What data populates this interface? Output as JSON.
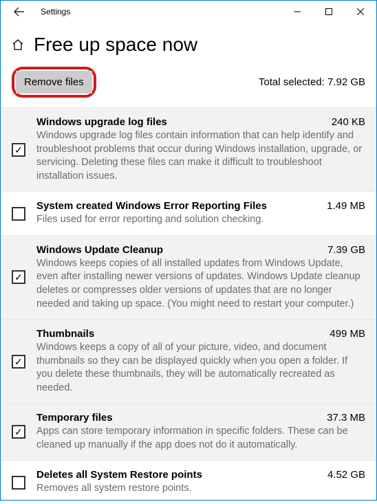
{
  "window": {
    "title": "Settings"
  },
  "page": {
    "title": "Free up space now"
  },
  "action": {
    "remove_label": "Remove files",
    "total_label": "Total selected: 7.92 GB"
  },
  "items": [
    {
      "title": "Windows upgrade log files",
      "size": "240 KB",
      "desc": "Windows upgrade log files contain information that can help identify and troubleshoot problems that occur during Windows installation, upgrade, or servicing.  Deleting these files can make it difficult to troubleshoot installation issues.",
      "checked": true
    },
    {
      "title": "System created Windows Error Reporting Files",
      "size": "1.49 MB",
      "desc": "Files used for error reporting and solution checking.",
      "checked": false
    },
    {
      "title": "Windows Update Cleanup",
      "size": "7.39 GB",
      "desc": "Windows keeps copies of all installed updates from Windows Update, even after installing newer versions of updates. Windows Update cleanup deletes or compresses older versions of updates that are no longer needed and taking up space. (You might need to restart your computer.)",
      "checked": true
    },
    {
      "title": "Thumbnails",
      "size": "499 MB",
      "desc": "Windows keeps a copy of all of your picture, video, and document thumbnails so they can be displayed quickly when you open a folder. If you delete these thumbnails, they will be automatically recreated as needed.",
      "checked": true
    },
    {
      "title": "Temporary files",
      "size": "37.3 MB",
      "desc": "Apps can store temporary information in specific folders. These can be cleaned up manually if the app does not do it automatically.",
      "checked": true
    },
    {
      "title": "Deletes all System Restore points",
      "size": "4.52 GB",
      "desc": "Removes all system restore points.",
      "checked": false
    }
  ]
}
